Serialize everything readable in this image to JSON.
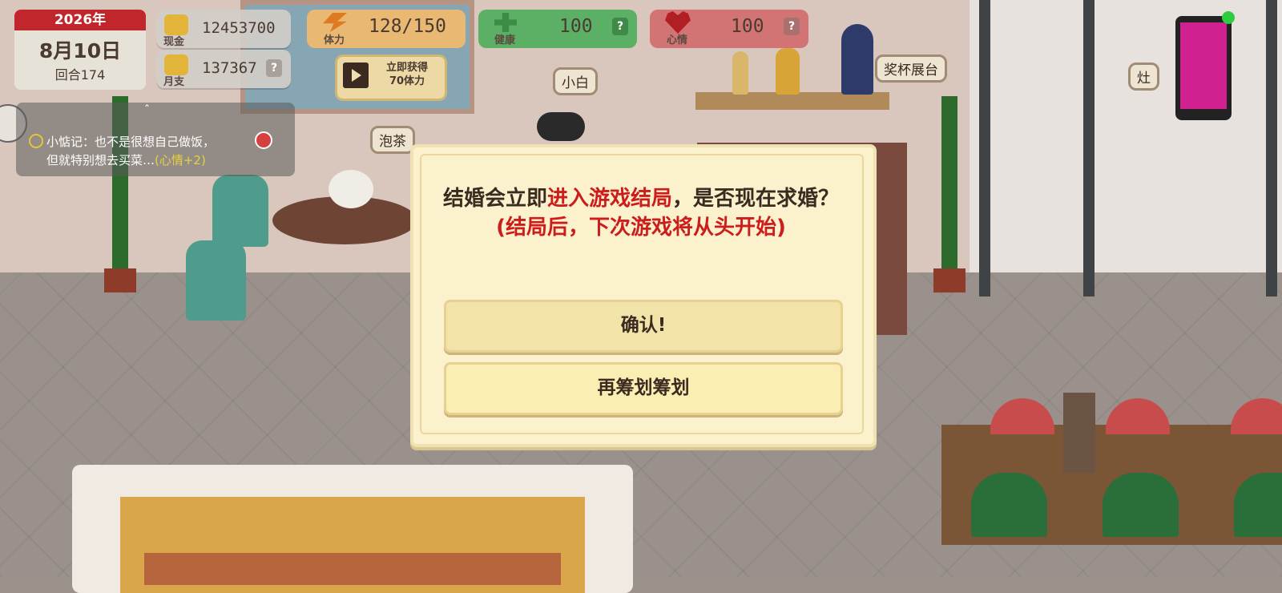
{
  "hud": {
    "date": {
      "year": "2026年",
      "day": "8月10日",
      "round": "回合174"
    },
    "cash": {
      "label": "现金",
      "value": "12453700"
    },
    "monthly": {
      "label": "月支",
      "value": "137367",
      "help": "?"
    },
    "stamina": {
      "label": "体力",
      "value": "128/150"
    },
    "stamina_ad": {
      "line1": "立即获得",
      "line2": "70体力"
    },
    "health": {
      "label": "健康",
      "value": "100",
      "help": "?"
    },
    "mood": {
      "label": "心情",
      "value": "100",
      "help": "?"
    }
  },
  "chat_log": {
    "toggle": "ˆ",
    "line1": "小惦记：也不是很想自己做饭，",
    "line2": "但就特别想去买菜…",
    "highlight": "(心情+2)"
  },
  "scene_tags": {
    "cat": "小白",
    "tea": "泡茶",
    "trophy": "奖杯展台",
    "stove": "灶"
  },
  "dialog": {
    "msg_part1": "结婚会立即",
    "msg_red": "进入游戏结局",
    "msg_part2": "，是否现在求婚？",
    "msg_note": "(结局后，下次游戏将从头开始)",
    "confirm": "确认!",
    "cancel": "再筹划筹划"
  },
  "colors": {
    "accent_red": "#cc1d1d",
    "dialog_bg": "#fbf1cd",
    "stamina": "#e9b873",
    "health": "#5cb065",
    "mood": "#d27473"
  }
}
